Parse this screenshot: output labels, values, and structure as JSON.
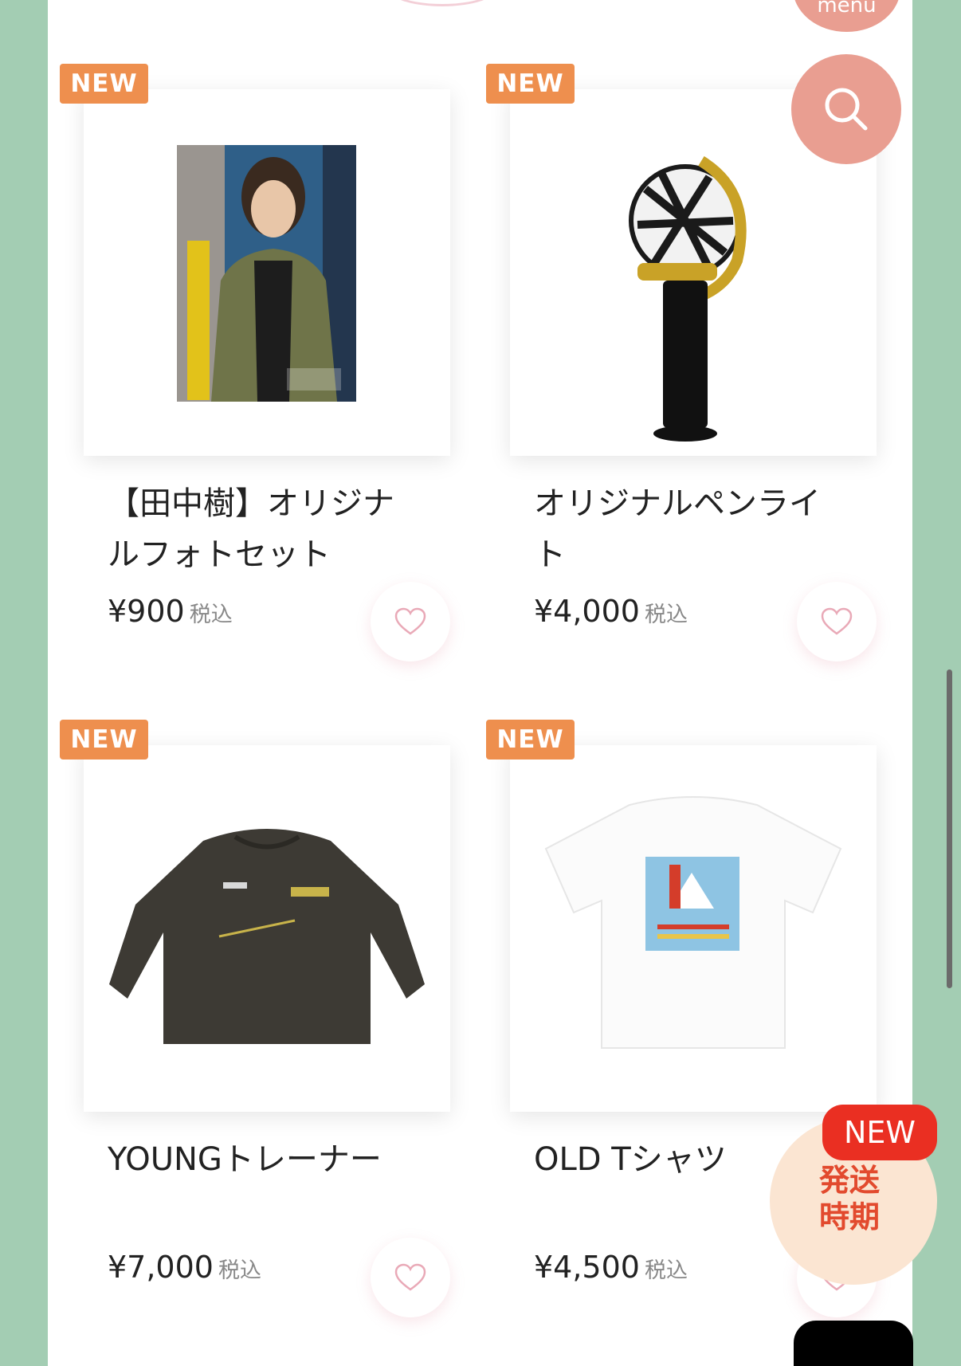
{
  "header": {
    "menu_label": "menu",
    "search_icon": "search-icon"
  },
  "products": [
    {
      "badge": "NEW",
      "title": "【田中樹】オリジナルフォトセット",
      "price": "¥900",
      "tax": "税込"
    },
    {
      "badge": "NEW",
      "title": "オリジナルペンライト",
      "price": "¥4,000",
      "tax": "税込"
    },
    {
      "badge": "NEW",
      "title": "YOUNGトレーナー",
      "price": "¥7,000",
      "tax": "税込"
    },
    {
      "badge": "NEW",
      "title": "OLD Tシャツ",
      "price": "¥4,500",
      "tax": "税込"
    }
  ],
  "shipping_banner": {
    "new_label": "NEW",
    "text": "発送時期"
  },
  "colors": {
    "badge": "#ee8f4e",
    "accent": "#e99e91",
    "background": "#a3cdb3"
  }
}
